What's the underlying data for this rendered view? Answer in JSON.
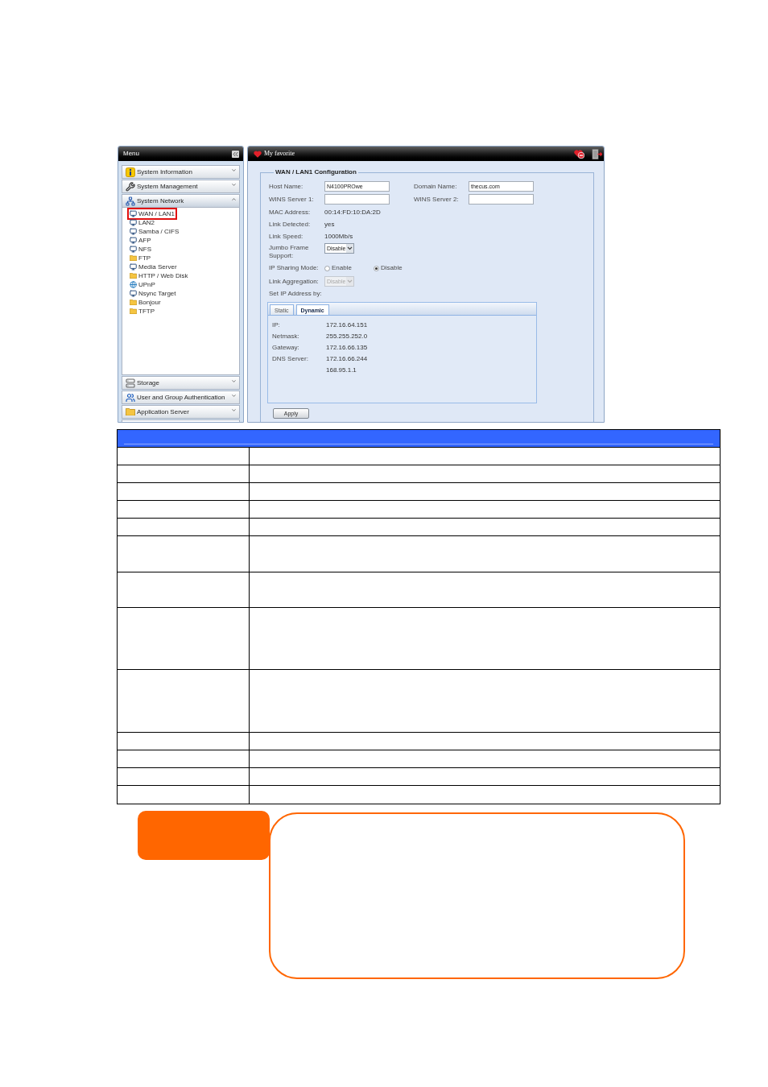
{
  "menu": {
    "title": "Menu",
    "sections": [
      {
        "label": "System Information",
        "expanded": false
      },
      {
        "label": "System Management",
        "expanded": false
      },
      {
        "label": "System Network",
        "expanded": true,
        "items": [
          {
            "label": "WAN / LAN1",
            "selected": true
          },
          {
            "label": "LAN2",
            "selected": false
          },
          {
            "label": "Samba / CIFS",
            "selected": false
          },
          {
            "label": "AFP",
            "selected": false
          },
          {
            "label": "NFS",
            "selected": false
          },
          {
            "label": "FTP",
            "selected": false
          },
          {
            "label": "Media Server",
            "selected": false
          },
          {
            "label": "HTTP / Web Disk",
            "selected": false
          },
          {
            "label": "UPnP",
            "selected": false
          },
          {
            "label": "Nsync Target",
            "selected": false
          },
          {
            "label": "Bonjour",
            "selected": false
          },
          {
            "label": "TFTP",
            "selected": false
          }
        ]
      },
      {
        "label": "Storage",
        "expanded": false
      },
      {
        "label": "User and Group Authentication",
        "expanded": false
      },
      {
        "label": "Application Server",
        "expanded": false
      }
    ]
  },
  "favorites_bar": {
    "title": "My favorite"
  },
  "config": {
    "title": "WAN / LAN1 Configuration",
    "host_name": {
      "label": "Host Name:",
      "value": "N4100PROwe"
    },
    "domain_name": {
      "label": "Domain Name:",
      "value": "thecus.com"
    },
    "wins_server_1": {
      "label": "WINS Server 1:"
    },
    "wins_server_2": {
      "label": "WINS Server 2:"
    },
    "status": [
      {
        "label": "MAC Address:",
        "value": "00:14:FD:10:DA:2D"
      },
      {
        "label": "Link Detected:",
        "value": "yes"
      },
      {
        "label": "Link Speed:",
        "value": "1000Mb/s"
      }
    ],
    "jumbo_frame": {
      "label": "Jumbo Frame Support:",
      "value": "Disable",
      "disabled": false
    },
    "ip_sharing": {
      "label": "IP Sharing Mode:",
      "options": [
        {
          "label": "Enable",
          "selected": false
        },
        {
          "label": "Disable",
          "selected": true
        }
      ]
    },
    "link_aggregation": {
      "label": "Link Aggregation:",
      "value": "Disable",
      "disabled": true
    },
    "set_ip_label": "Set IP Address by:",
    "ip_tabs": [
      {
        "label": "Static",
        "selected": false
      },
      {
        "label": "Dynamic",
        "selected": true
      }
    ],
    "dynamic_ip": [
      {
        "label": "IP:",
        "value": "172.16.64.151"
      },
      {
        "label": "Netmask:",
        "value": "255.255.252.0"
      },
      {
        "label": "Gateway:",
        "value": "172.16.66.135"
      },
      {
        "label": "DNS Server:",
        "value": "172.16.66.244"
      },
      {
        "value": "168.95.1.1"
      }
    ],
    "apply_button": "Apply"
  }
}
